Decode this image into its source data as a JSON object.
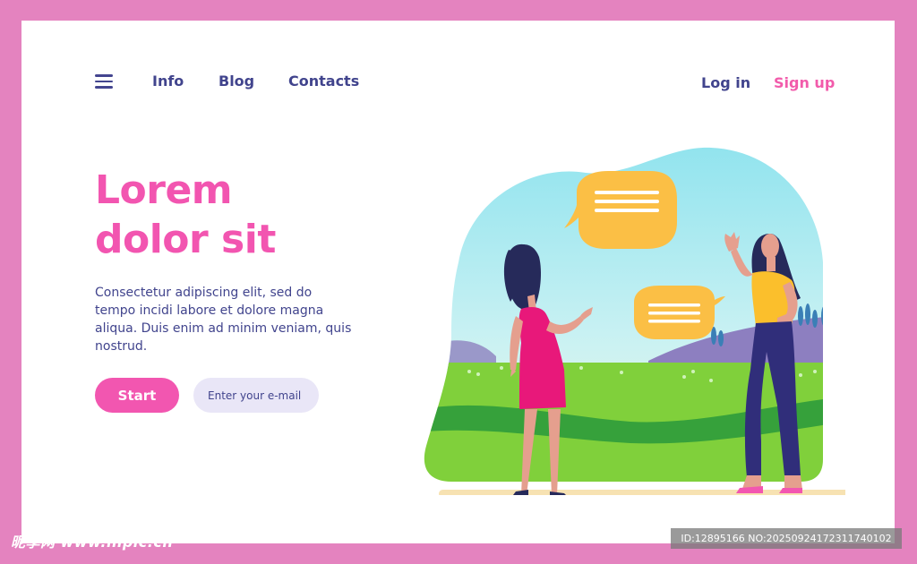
{
  "nav": {
    "items": [
      {
        "label": "Info"
      },
      {
        "label": "Blog"
      },
      {
        "label": "Contacts"
      }
    ],
    "menu_icon": "hamburger-menu-icon"
  },
  "auth": {
    "login_label": "Log in",
    "signup_label": "Sign up"
  },
  "hero": {
    "title_line1": "Lorem",
    "title_line2": "dolor sit",
    "text": "Consectetur adipiscing elit, sed do tempo incidi labore et dolore magna aliqua. Duis enim ad minim veniam, quis nostrud.",
    "start_label": "Start",
    "email_placeholder": "Enter your e-mail"
  },
  "colors": {
    "frame": "#e483bf",
    "accent_pink": "#f256b0",
    "navy": "#41448d",
    "input_bg": "#e9e6f7",
    "speech_bubble": "#fbbf45",
    "grass": "#7fd13b"
  },
  "watermark": {
    "left": "昵享网 www.nipic.cn",
    "right": "ID:12895166 NO:20250924172311740102"
  }
}
